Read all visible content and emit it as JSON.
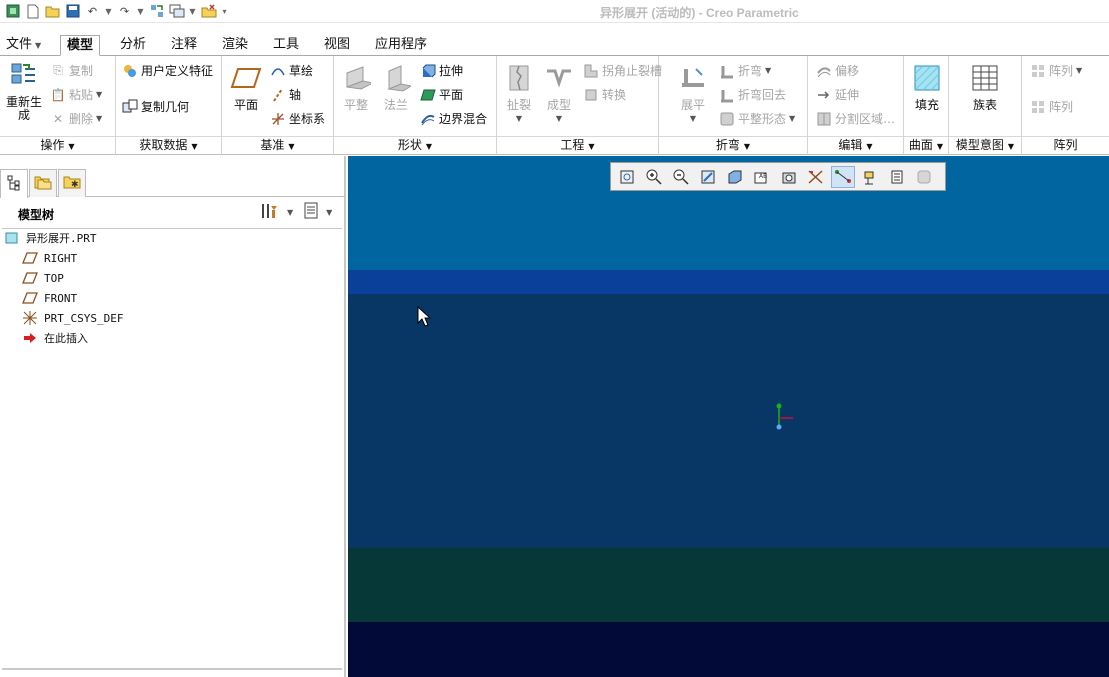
{
  "window": {
    "title": "异形展开 (活动的) - Creo Parametric"
  },
  "quick_access": {
    "icons": [
      "app-icon",
      "new-icon",
      "open-icon",
      "save-icon",
      "undo-icon",
      "undo-dropdown-icon",
      "redo-icon",
      "redo-dropdown-icon",
      "regenerate-icon",
      "switch-window-icon",
      "switch-window-dropdown-icon",
      "close-icon",
      "customize-icon"
    ]
  },
  "tabs": [
    "文件",
    "模型",
    "分析",
    "注释",
    "渲染",
    "工具",
    "视图",
    "应用程序"
  ],
  "active_tab": "模型",
  "ribbon": {
    "operations": {
      "label": "操作",
      "regenerate": "重新生成",
      "copy": "复制",
      "paste": "粘贴",
      "delete": "删除"
    },
    "get_data": {
      "label": "获取数据",
      "udf": "用户定义特征",
      "copy_geom": "复制几何"
    },
    "datum": {
      "label": "基准",
      "plane": "平面",
      "sketch": "草绘",
      "axis": "轴",
      "csys": "坐标系"
    },
    "shapes": {
      "label": "形状",
      "flat": "平整",
      "flange": "法兰",
      "extrude": "拉伸",
      "planar": "平面",
      "boundary_blend": "边界混合"
    },
    "engineering": {
      "label": "工程",
      "rip": "扯裂",
      "form": "成型",
      "corner_relief": "拐角止裂槽",
      "convert": "转换"
    },
    "bend": {
      "label": "折弯",
      "unbend": "展平",
      "bend": "折弯",
      "bend_back": "折弯回去",
      "flat_state": "平整形态"
    },
    "editing": {
      "label": "编辑",
      "offset": "偏移",
      "extend": "延伸",
      "split_area": "分割区域…"
    },
    "surfaces": {
      "label": "曲面",
      "fill": "填充"
    },
    "model_intent": {
      "label": "模型意图",
      "family_table": "族表"
    },
    "pattern": {
      "label": "阵列",
      "pattern1": "阵列",
      "pattern2": "阵列"
    }
  },
  "model_tree": {
    "title": "模型树",
    "items": [
      {
        "label": "异形展开.PRT",
        "icon": "part-icon"
      },
      {
        "label": "RIGHT",
        "icon": "datum-plane-icon"
      },
      {
        "label": "TOP",
        "icon": "datum-plane-icon"
      },
      {
        "label": "FRONT",
        "icon": "datum-plane-icon"
      },
      {
        "label": "PRT_CSYS_DEF",
        "icon": "csys-icon"
      },
      {
        "label": "在此插入",
        "icon": "insert-here-arrow-icon"
      }
    ]
  },
  "view_toolbar": {
    "buttons": [
      "refit-icon",
      "zoom-in-icon",
      "zoom-out-icon",
      "repaint-icon",
      "display-style-icon",
      "saved-orientations-icon",
      "view-manager-icon",
      "plane-display-icon",
      "axis-display-icon",
      "point-display-icon",
      "csys-display-icon",
      "spin-center-icon",
      "annotation-display-icon"
    ]
  },
  "colors": {
    "viewport_bg": "#0b3566",
    "ribbon_disabled": "#a5a5a5",
    "accent_blue": "#1f6fb2"
  }
}
